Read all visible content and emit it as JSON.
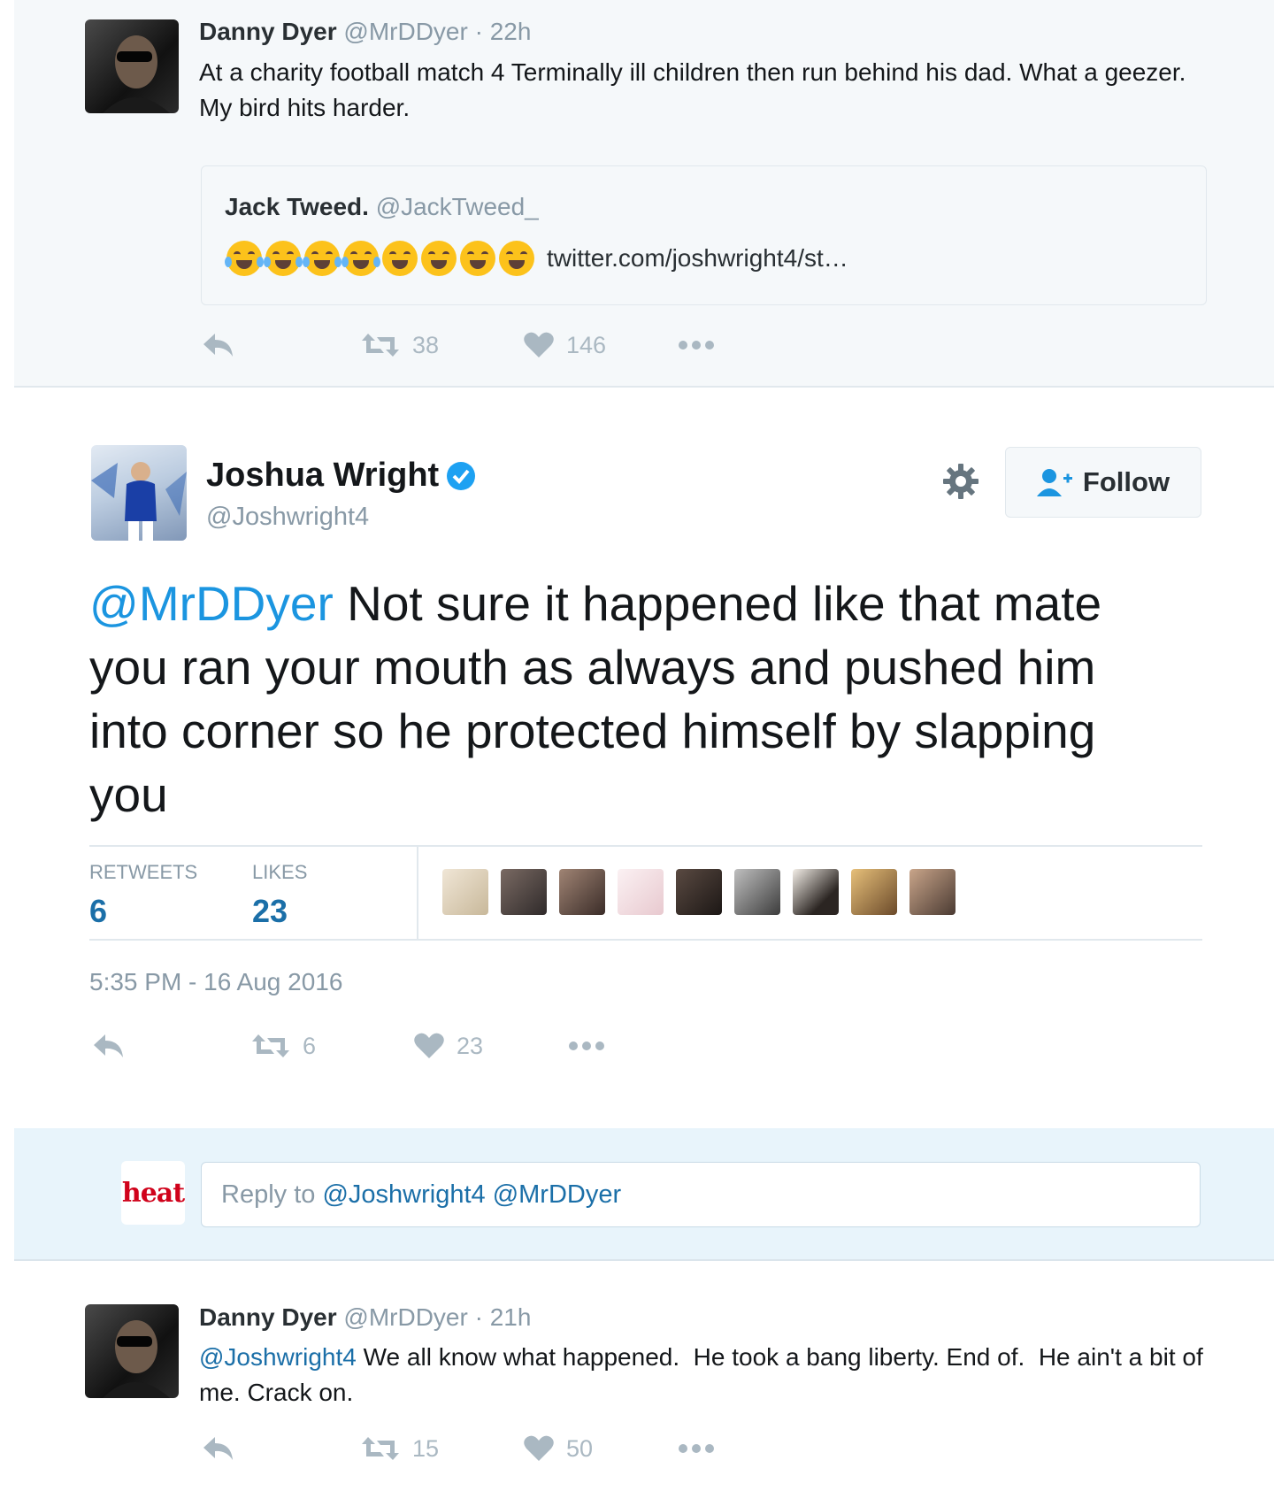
{
  "tweet1": {
    "author_name": "Danny Dyer",
    "handle": "@MrDDyer",
    "time": "· 22h",
    "text": "At a charity football match 4 Terminally ill children then run behind his dad. What a geezer. My bird hits harder.",
    "quote": {
      "author_name": "Jack Tweed.",
      "handle": "@JackTweed_",
      "link": "twitter.com/joshwright4/st…"
    },
    "retweets": "38",
    "likes": "146"
  },
  "main_tweet": {
    "author_name": "Joshua Wright",
    "handle": "@Joshwright4",
    "follow_label": "Follow",
    "mention": "@MrDDyer",
    "text": " Not sure it happened like that mate you ran your mouth as always and pushed him into corner so he protected himself by slapping you",
    "retweets_label": "RETWEETS",
    "retweets_count": "6",
    "likes_label": "LIKES",
    "likes_count": "23",
    "timestamp": "5:35 PM - 16 Aug 2016",
    "action_retweets": "6",
    "action_likes": "23"
  },
  "reply_box": {
    "logo_text": "heat",
    "prefix": "Reply to ",
    "mentions": "@Joshwright4 @MrDDyer"
  },
  "tweet3": {
    "author_name": "Danny Dyer",
    "handle": "@MrDDyer",
    "time": "· 21h",
    "mention": "@Joshwright4",
    "text": " We all know what happened.  He took a bang liberty. End of.  He ain't a bit of me. Crack on.",
    "retweets": "15",
    "likes": "50"
  },
  "colors": {
    "link_blue": "#1b95e0",
    "muted_gray": "#8899a6",
    "band_bg": "#f5f8fa",
    "verified_blue": "#1da1f2",
    "heat_red": "#d0021b"
  }
}
